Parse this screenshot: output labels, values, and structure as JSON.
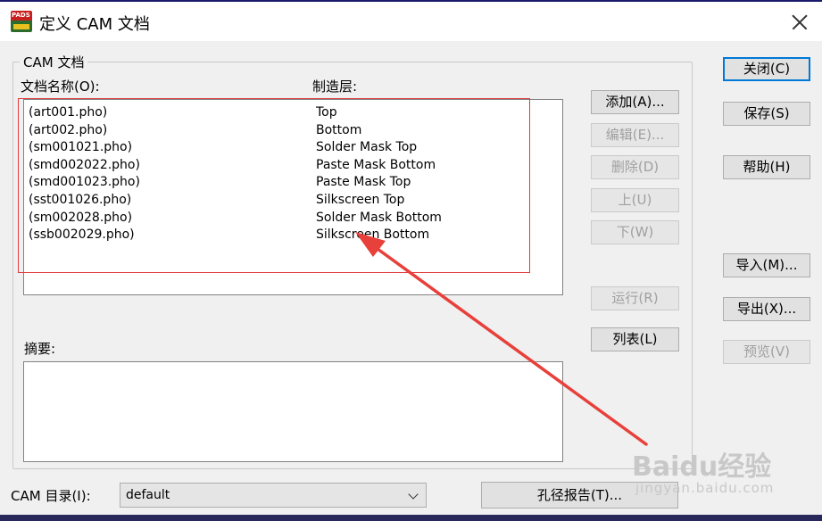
{
  "window": {
    "title": "定义 CAM 文档",
    "app_icon_text": "PADS"
  },
  "cam_group": {
    "label": "CAM 文档",
    "doc_name_header": "文档名称(O):",
    "layer_header": "制造层:",
    "documents": [
      {
        "name": "(art001.pho)",
        "layer": "Top"
      },
      {
        "name": "(art002.pho)",
        "layer": "Bottom"
      },
      {
        "name": "(sm001021.pho)",
        "layer": "Solder Mask Top"
      },
      {
        "name": "(smd002022.pho)",
        "layer": "Paste Mask Bottom"
      },
      {
        "name": "(smd001023.pho)",
        "layer": "Paste Mask Top"
      },
      {
        "name": "(sst001026.pho)",
        "layer": "Silkscreen Top"
      },
      {
        "name": "(sm002028.pho)",
        "layer": "Solder Mask Bottom"
      },
      {
        "name": "(ssb002029.pho)",
        "layer": "Silkscreen Bottom"
      }
    ],
    "summary_label": "摘要:"
  },
  "list_buttons": {
    "add": "添加(A)...",
    "edit": "编辑(E)...",
    "delete": "删除(D)",
    "up": "上(U)",
    "down": "下(W)",
    "run": "运行(R)",
    "list": "列表(L)"
  },
  "side_buttons": {
    "close": "关闭(C)",
    "save": "保存(S)",
    "help": "帮助(H)",
    "import": "导入(M)...",
    "export": "导出(X)...",
    "preview": "预览(V)"
  },
  "footer": {
    "cam_dir_label": "CAM 目录(I):",
    "cam_dir_value": "default",
    "drill_report": "孔径报告(T)..."
  },
  "watermark": {
    "brand": "Baidu经验",
    "url": "jingyan.baidu.com"
  },
  "colors": {
    "highlight_box": "#e03c3c",
    "arrow": "#e8403a",
    "default_button_border": "#0078d7"
  }
}
